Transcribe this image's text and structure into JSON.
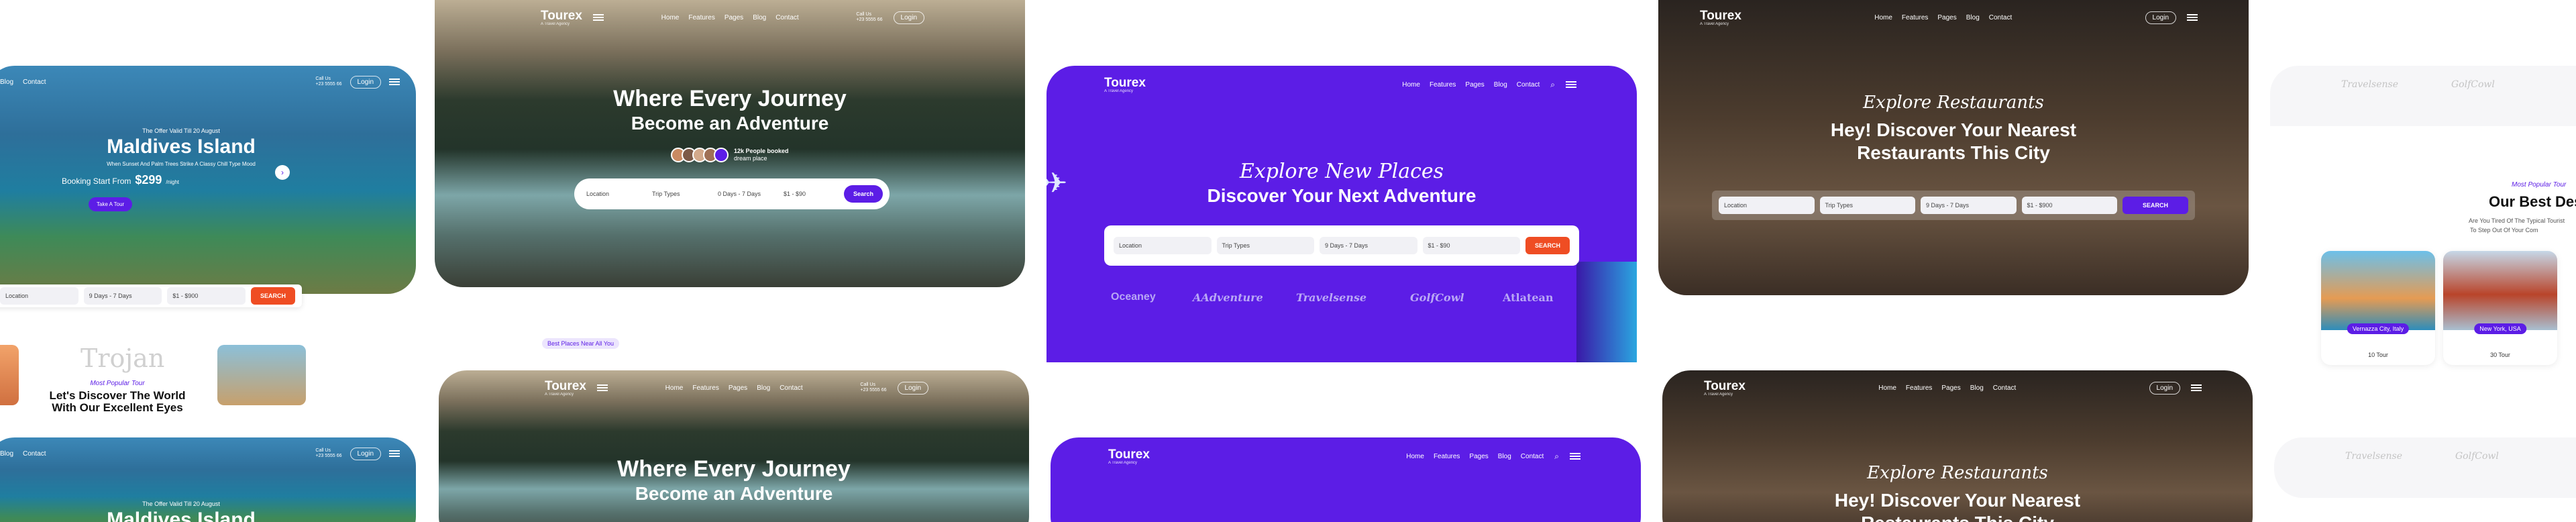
{
  "brand": {
    "name": "Tourex",
    "tagline": "A Travel Agency"
  },
  "nav": {
    "home": "Home",
    "features": "Features",
    "pages": "Pages",
    "blog": "Blog",
    "contact": "Contact",
    "login": "Login",
    "call_label": "Call Us",
    "phone": "+23 5555 66"
  },
  "island": {
    "eyebrow": "The Offer Valid Till 20 August",
    "title": "Maldives Island",
    "desc": "When Sunset And Palm Trees Strike A Classy Chill Type Mood",
    "price_prefix": "Booking Start From",
    "price": "$299",
    "price_suffix": "/night",
    "cta": "Take A Tour",
    "popular_label": "Most Popular Tour",
    "section_title_1": "Let's Discover The World",
    "section_title_2": "With Our Excellent Eyes",
    "partner": "Trojan",
    "search": {
      "location": "Location",
      "dates": "9 Days - 7 Days",
      "price": "$1 - $900",
      "button": "SEARCH"
    }
  },
  "journey": {
    "title_1": "Where Every Journey",
    "title_2": "Become an Adventure",
    "booked": "12k People booked",
    "booked_sub": "dream place",
    "search": {
      "location": "Location",
      "type": "Trip Types",
      "days": "0 Days - 7 Days",
      "price": "$1 - $90",
      "button": "Search"
    },
    "tag": "Best Places Near All You"
  },
  "adventure": {
    "script": "Explore New Places",
    "title": "Discover Your Next Adventure",
    "search": {
      "location": "Location",
      "type": "Trip Types",
      "days": "9 Days - 7 Days",
      "price": "$1 - $90",
      "button": "SEARCH"
    },
    "partners": [
      "Oceaney",
      "AAdventure",
      "Travelsense",
      "GolfCowl",
      "Atlatean"
    ]
  },
  "restaurant": {
    "script": "Explore Restaurants",
    "title_1": "Hey! Discover Your Nearest",
    "title_2": "Restaurants This City",
    "search": {
      "location": "Location",
      "type": "Trip Types",
      "days": "9 Days - 7 Days",
      "price": "$1 - $900",
      "button": "SEARCH"
    }
  },
  "destinations": {
    "partners": [
      "Travelsense",
      "GolfCowl"
    ],
    "popular_label": "Most Popular Tour",
    "title": "Our Best Des",
    "desc_1": "Are You Tired Of The Typical Tourist",
    "desc_2": "To Step Out Of Your Com",
    "cards": [
      {
        "place": "Vernazza City, Italy",
        "count": "10 Tour"
      },
      {
        "place": "New York, USA",
        "count": "30 Tour"
      }
    ]
  },
  "colors": {
    "purple": "#5c1de6",
    "orange": "#ef4d23",
    "dark": "#111111"
  }
}
